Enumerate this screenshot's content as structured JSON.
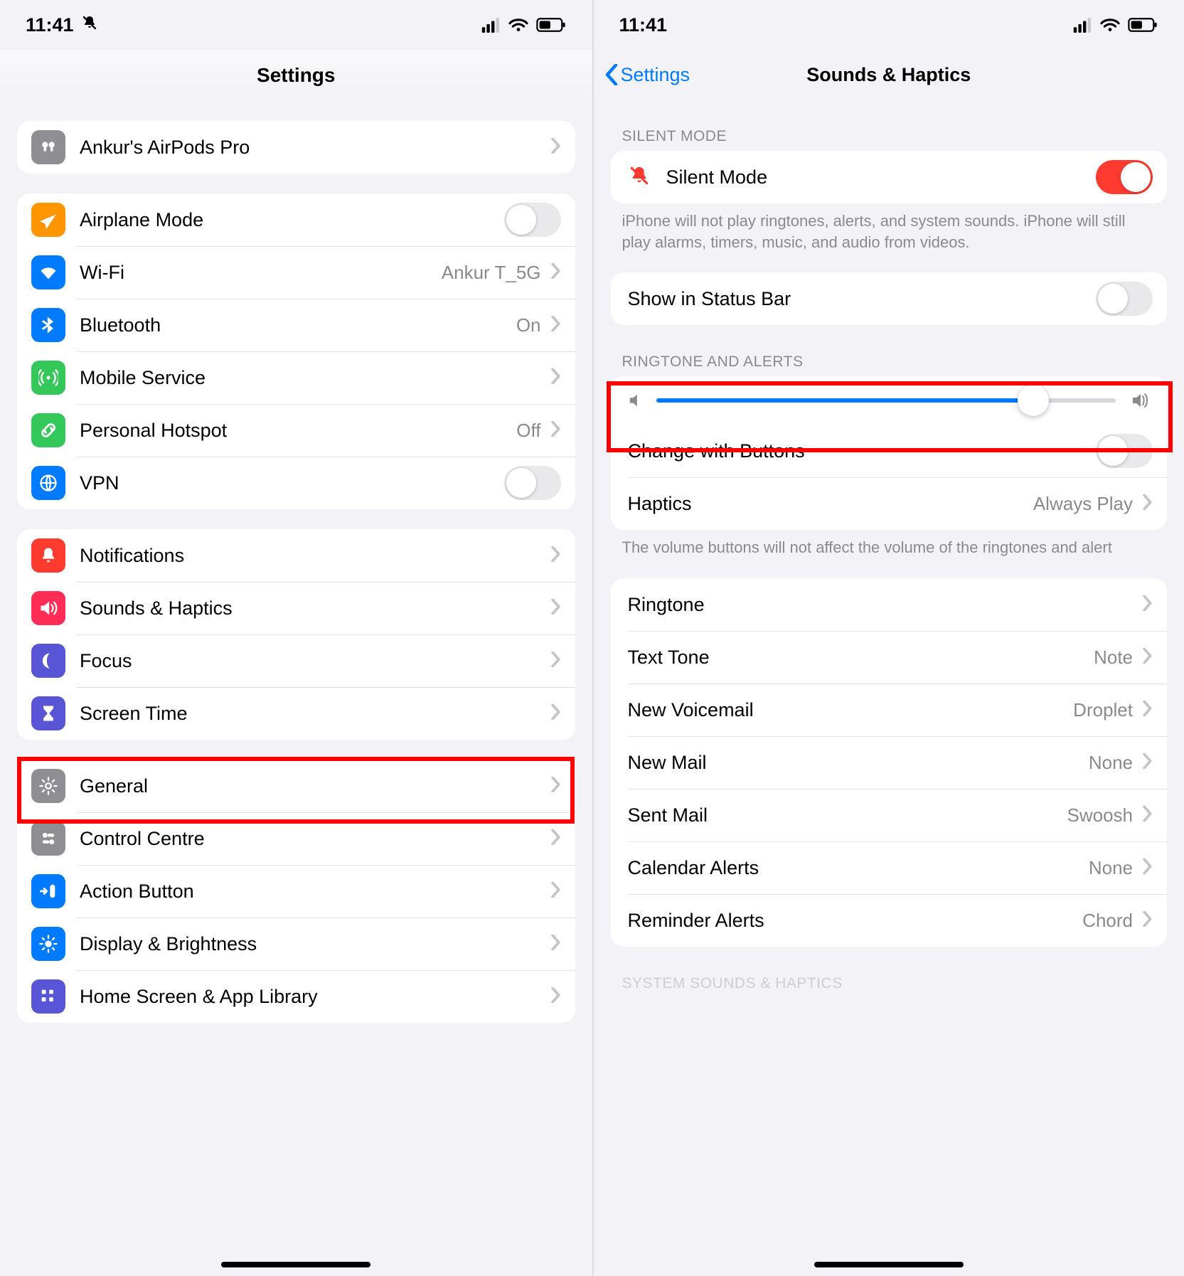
{
  "status": {
    "time": "11:41"
  },
  "left": {
    "title": "Settings",
    "airpods": {
      "label": "Ankur's AirPods Pro"
    },
    "rows": {
      "airplane": {
        "label": "Airplane Mode"
      },
      "wifi": {
        "label": "Wi-Fi",
        "detail": "Ankur T_5G"
      },
      "bluetooth": {
        "label": "Bluetooth",
        "detail": "On"
      },
      "mobile": {
        "label": "Mobile Service"
      },
      "hotspot": {
        "label": "Personal Hotspot",
        "detail": "Off"
      },
      "vpn": {
        "label": "VPN"
      },
      "notifications": {
        "label": "Notifications"
      },
      "sounds": {
        "label": "Sounds & Haptics"
      },
      "focus": {
        "label": "Focus"
      },
      "screentime": {
        "label": "Screen Time"
      },
      "general": {
        "label": "General"
      },
      "control": {
        "label": "Control Centre"
      },
      "action": {
        "label": "Action Button"
      },
      "display": {
        "label": "Display & Brightness"
      },
      "home": {
        "label": "Home Screen & App Library"
      }
    }
  },
  "right": {
    "back": "Settings",
    "title": "Sounds & Haptics",
    "section_silent_header": "SILENT MODE",
    "silent": {
      "label": "Silent Mode",
      "on": true
    },
    "silent_footer": "iPhone will not play ringtones, alerts, and system sounds. iPhone will still play alarms, timers, music, and audio from videos.",
    "show_in_status": {
      "label": "Show in Status Bar",
      "on": false
    },
    "section_ring_header": "RINGTONE AND ALERTS",
    "volume_percent": 82,
    "change_buttons": {
      "label": "Change with Buttons",
      "on": false
    },
    "haptics": {
      "label": "Haptics",
      "detail": "Always Play"
    },
    "ring_footer": "The volume buttons will not affect the volume of the ringtones and alert",
    "tones": {
      "ringtone": {
        "label": "Ringtone",
        "detail": ""
      },
      "text": {
        "label": "Text Tone",
        "detail": "Note"
      },
      "voicemail": {
        "label": "New Voicemail",
        "detail": "Droplet"
      },
      "mail": {
        "label": "New Mail",
        "detail": "None"
      },
      "sent": {
        "label": "Sent Mail",
        "detail": "Swoosh"
      },
      "calendar": {
        "label": "Calendar Alerts",
        "detail": "None"
      },
      "reminder": {
        "label": "Reminder Alerts",
        "detail": "Chord"
      }
    },
    "section_system_header": "SYSTEM SOUNDS & HAPTICS"
  },
  "colors": {
    "orange": "#ff9500",
    "blue": "#007aff",
    "green": "#34c759",
    "red": "#ff3b30",
    "purple": "#5856d6",
    "indigo": "#5e5ce6",
    "gray": "#8e8e93",
    "pink": "#ff2d55"
  }
}
